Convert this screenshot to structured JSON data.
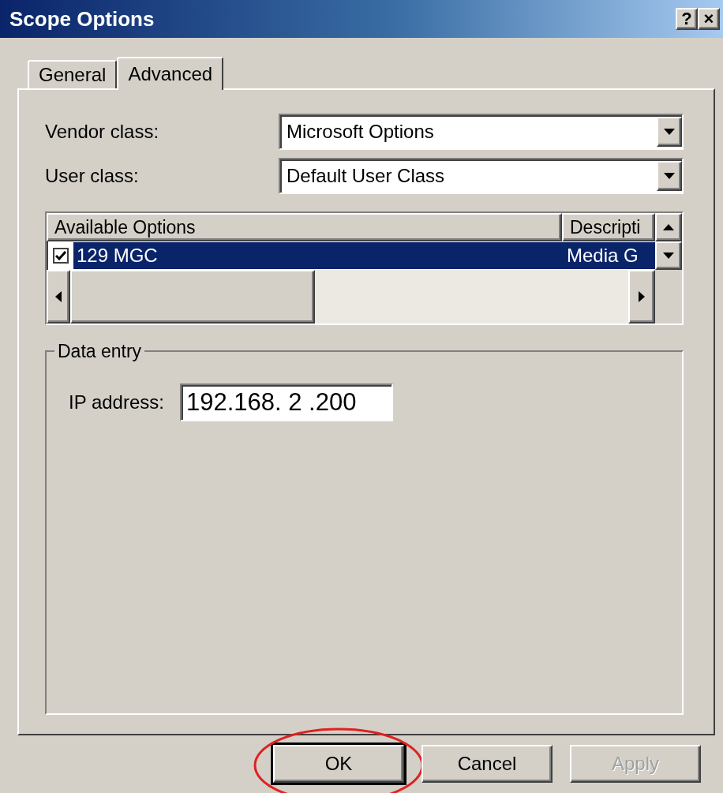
{
  "window": {
    "title": "Scope Options"
  },
  "title_buttons": [
    {
      "label": "?"
    },
    {
      "label": "×"
    }
  ],
  "tabs": [
    {
      "label": "General",
      "selected": false
    },
    {
      "label": "Advanced",
      "selected": true
    }
  ],
  "fields": [
    {
      "label": "Vendor class:",
      "value": "Microsoft Options"
    },
    {
      "label": "User class:",
      "value": "Default User Class"
    }
  ],
  "options_list": {
    "columns": [
      "Available Options",
      "Descripti"
    ],
    "rows": [
      {
        "checked": true,
        "selected": true,
        "name": "129 MGC",
        "description": "Media G"
      }
    ]
  },
  "data_entry": {
    "title": "Data entry",
    "label": "IP address:",
    "value": "192.168. 2 .200"
  },
  "buttons": [
    {
      "label": "OK",
      "default": true,
      "disabled": false,
      "circled": true
    },
    {
      "label": "Cancel",
      "default": false,
      "disabled": false,
      "circled": false
    },
    {
      "label": "Apply",
      "default": false,
      "disabled": true,
      "circled": false
    }
  ]
}
